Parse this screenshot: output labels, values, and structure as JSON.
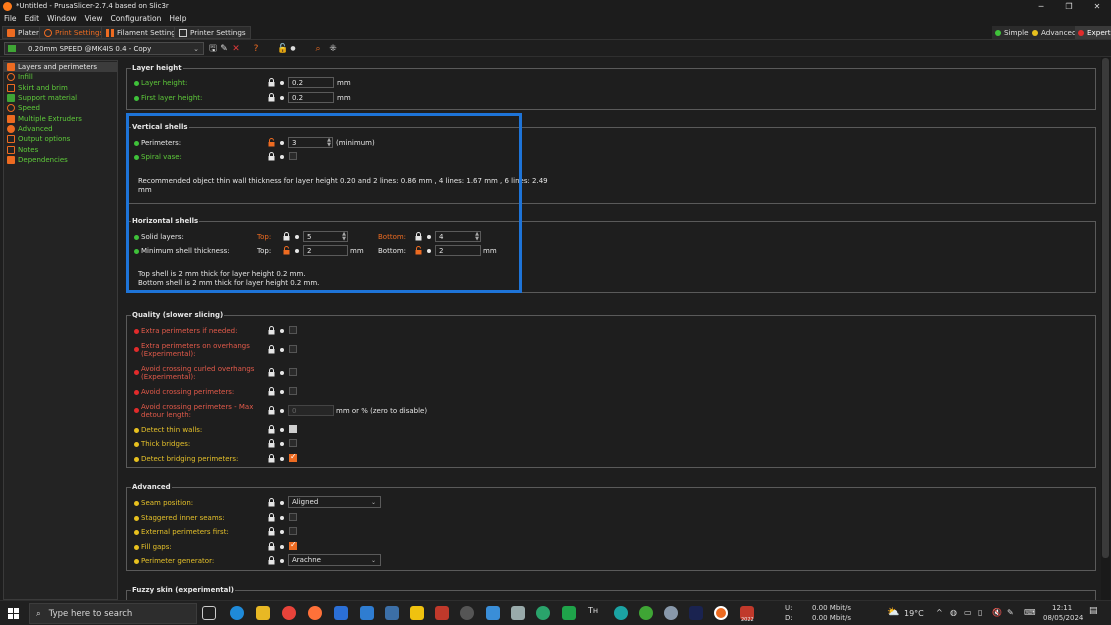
{
  "window": {
    "title": "*Untitled - PrusaSlicer-2.7.4 based on Slic3r",
    "controls": [
      "─",
      "❐",
      "✕"
    ]
  },
  "menu": [
    "File",
    "Edit",
    "Window",
    "View",
    "Configuration",
    "Help"
  ],
  "tabs": [
    {
      "label": "Plater",
      "active": false
    },
    {
      "label": "Print Settings",
      "active": true
    },
    {
      "label": "Filament Settings",
      "active": false
    },
    {
      "label": "Printer Settings",
      "active": false
    }
  ],
  "modes": [
    {
      "label": "Simple",
      "color": "#3fc23a"
    },
    {
      "label": "Advanced",
      "color": "#e8c11e"
    },
    {
      "label": "Expert",
      "color": "#e22b2b"
    }
  ],
  "preset": {
    "name": "0.20mm SPEED @MK4IS 0.4 - Copy"
  },
  "sidebar": [
    {
      "label": "Layers and perimeters",
      "selected": true,
      "color": "#ed6b21"
    },
    {
      "label": "Infill",
      "color": "#ed6b21"
    },
    {
      "label": "Skirt and brim",
      "color": "#ed6b21"
    },
    {
      "label": "Support material",
      "color": "#3fa535"
    },
    {
      "label": "Speed",
      "color": "#ed6b21"
    },
    {
      "label": "Multiple Extruders",
      "color": "#ed6b21"
    },
    {
      "label": "Advanced",
      "color": "#ed6b21"
    },
    {
      "label": "Output options",
      "color": "#ed6b21"
    },
    {
      "label": "Notes",
      "color": "#ed6b21"
    },
    {
      "label": "Dependencies",
      "color": "#ed6b21"
    }
  ],
  "layer_height": {
    "title": "Layer height",
    "layer_height_label": "Layer height:",
    "layer_height_value": "0.2",
    "first_layer_label": "First layer height:",
    "first_layer_value": "0.2",
    "unit": "mm"
  },
  "vertical_shells": {
    "title": "Vertical shells",
    "perimeters_label": "Perimeters:",
    "perimeters_value": "3",
    "perimeters_suffix": "(minimum)",
    "spiral_label": "Spiral vase:",
    "note_line1": "Recommended object thin wall thickness for layer height 0.20 and 2 lines: 0.86 mm , 4 lines: 1.67 mm , 6 lines: 2.49",
    "note_line2": "mm"
  },
  "horizontal_shells": {
    "title": "Horizontal shells",
    "solid_label": "Solid layers:",
    "top_label": "Top:",
    "top_value": "5",
    "bottom_label": "Bottom:",
    "bottom_value": "4",
    "min_label": "Minimum shell thickness:",
    "min_top_label": "Top:",
    "min_top_value": "2",
    "min_bottom_label": "Bottom:",
    "min_bottom_value": "2",
    "unit": "mm",
    "note_line1": "Top shell is 2 mm thick for layer height 0.2 mm.",
    "note_line2": "Bottom shell is 2 mm thick for layer height 0.2 mm."
  },
  "quality": {
    "title": "Quality (slower slicing)",
    "extra_perimeters": "Extra perimeters if needed:",
    "extra_overhangs_1": "Extra perimeters on overhangs",
    "extra_overhangs_2": "(Experimental):",
    "avoid_curled_1": "Avoid crossing curled overhangs",
    "avoid_curled_2": "(Experimental):",
    "avoid_crossing": "Avoid crossing perimeters:",
    "avoid_max_1": "Avoid crossing perimeters - Max",
    "avoid_max_2": "detour length:",
    "avoid_max_value": "0",
    "avoid_max_unit": "mm or % (zero to disable)",
    "thin_walls": "Detect thin walls:",
    "thick_bridges": "Thick bridges:",
    "bridging": "Detect bridging perimeters:"
  },
  "advanced": {
    "title": "Advanced",
    "seam_label": "Seam position:",
    "seam_value": "Aligned",
    "staggered": "Staggered inner seams:",
    "external_first": "External perimeters first:",
    "fill_gaps": "Fill gaps:",
    "generator_label": "Perimeter generator:",
    "generator_value": "Arachne"
  },
  "fuzzy": {
    "title": "Fuzzy skin (experimental)"
  },
  "taskbar": {
    "search_placeholder": "Type here to search",
    "net_up_label": "U:",
    "net_up": "0.00 Mbit/s",
    "net_down_label": "D:",
    "net_down": "0.00 Mbit/s",
    "temperature": "19°C",
    "time": "12:11",
    "date": "08/05/2024",
    "sw_badge": "2022"
  }
}
